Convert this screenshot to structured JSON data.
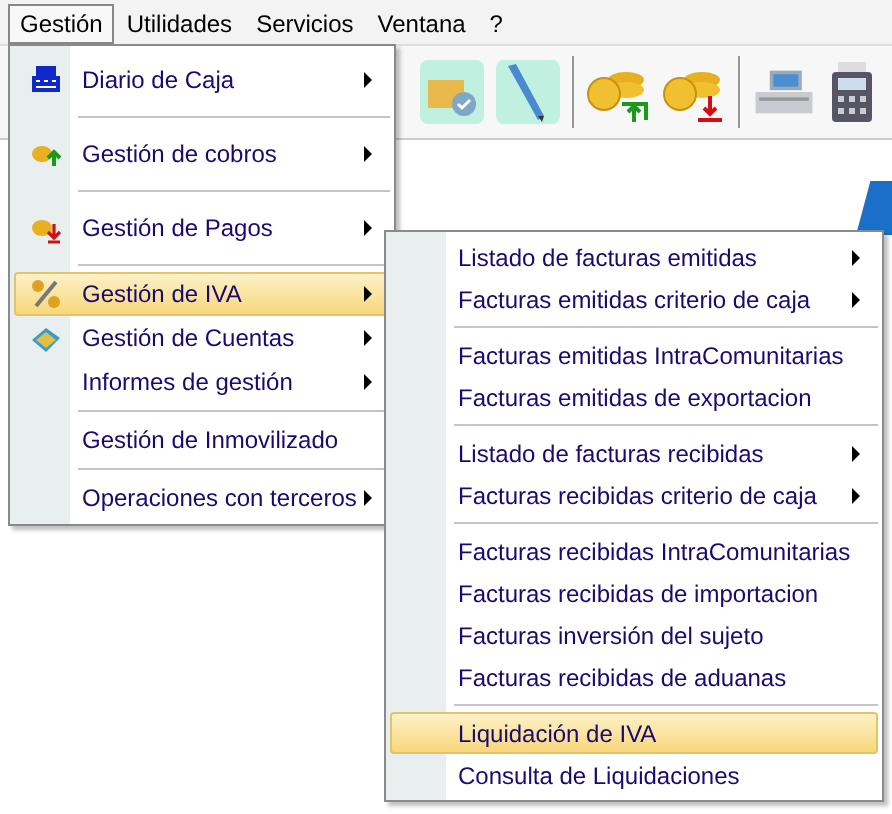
{
  "menubar": [
    {
      "label": "Gestión",
      "selected": true
    },
    {
      "label": "Utilidades",
      "selected": false
    },
    {
      "label": "Servicios",
      "selected": false
    },
    {
      "label": "Ventana",
      "selected": false
    },
    {
      "label": "?",
      "selected": false
    }
  ],
  "menu": {
    "items": [
      {
        "kind": "item",
        "label": "Diario de Caja",
        "submenu": true,
        "selected": false
      },
      {
        "kind": "separator"
      },
      {
        "kind": "item",
        "label": "Gestión de cobros",
        "submenu": true,
        "selected": false
      },
      {
        "kind": "separator"
      },
      {
        "kind": "item",
        "label": "Gestión de Pagos",
        "submenu": true,
        "selected": false
      },
      {
        "kind": "separator"
      },
      {
        "kind": "item",
        "label": "Gestión de IVA",
        "submenu": true,
        "selected": true
      },
      {
        "kind": "item",
        "label": "Gestión de Cuentas",
        "submenu": true,
        "selected": false
      },
      {
        "kind": "item",
        "label": "Informes de gestión",
        "submenu": true,
        "selected": false
      },
      {
        "kind": "separator"
      },
      {
        "kind": "item",
        "label": "Gestión de Inmovilizado",
        "submenu": false,
        "selected": false
      },
      {
        "kind": "separator"
      },
      {
        "kind": "item",
        "label": "Operaciones con terceros",
        "submenu": true,
        "selected": false
      }
    ]
  },
  "submenu": {
    "items": [
      {
        "kind": "item",
        "label": "Listado de facturas emitidas",
        "submenu": true,
        "selected": false
      },
      {
        "kind": "item",
        "label": "Facturas emitidas criterio de caja",
        "submenu": true,
        "selected": false
      },
      {
        "kind": "separator"
      },
      {
        "kind": "item",
        "label": "Facturas emitidas IntraComunitarias",
        "submenu": false,
        "selected": false
      },
      {
        "kind": "item",
        "label": "Facturas emitidas de exportacion",
        "submenu": false,
        "selected": false
      },
      {
        "kind": "separator"
      },
      {
        "kind": "item",
        "label": "Listado de facturas recibidas",
        "submenu": true,
        "selected": false
      },
      {
        "kind": "item",
        "label": "Facturas recibidas criterio de caja",
        "submenu": true,
        "selected": false
      },
      {
        "kind": "separator"
      },
      {
        "kind": "item",
        "label": "Facturas recibidas IntraComunitarias",
        "submenu": false,
        "selected": false
      },
      {
        "kind": "item",
        "label": "Facturas recibidas de importacion",
        "submenu": false,
        "selected": false
      },
      {
        "kind": "item",
        "label": "Facturas inversión del sujeto",
        "submenu": false,
        "selected": false
      },
      {
        "kind": "item",
        "label": "Facturas recibidas de aduanas",
        "submenu": false,
        "selected": false
      },
      {
        "kind": "separator"
      },
      {
        "kind": "item",
        "label": "Liquidación de IVA",
        "submenu": false,
        "selected": true
      },
      {
        "kind": "item",
        "label": "Consulta de Liquidaciones",
        "submenu": false,
        "selected": false
      }
    ]
  }
}
